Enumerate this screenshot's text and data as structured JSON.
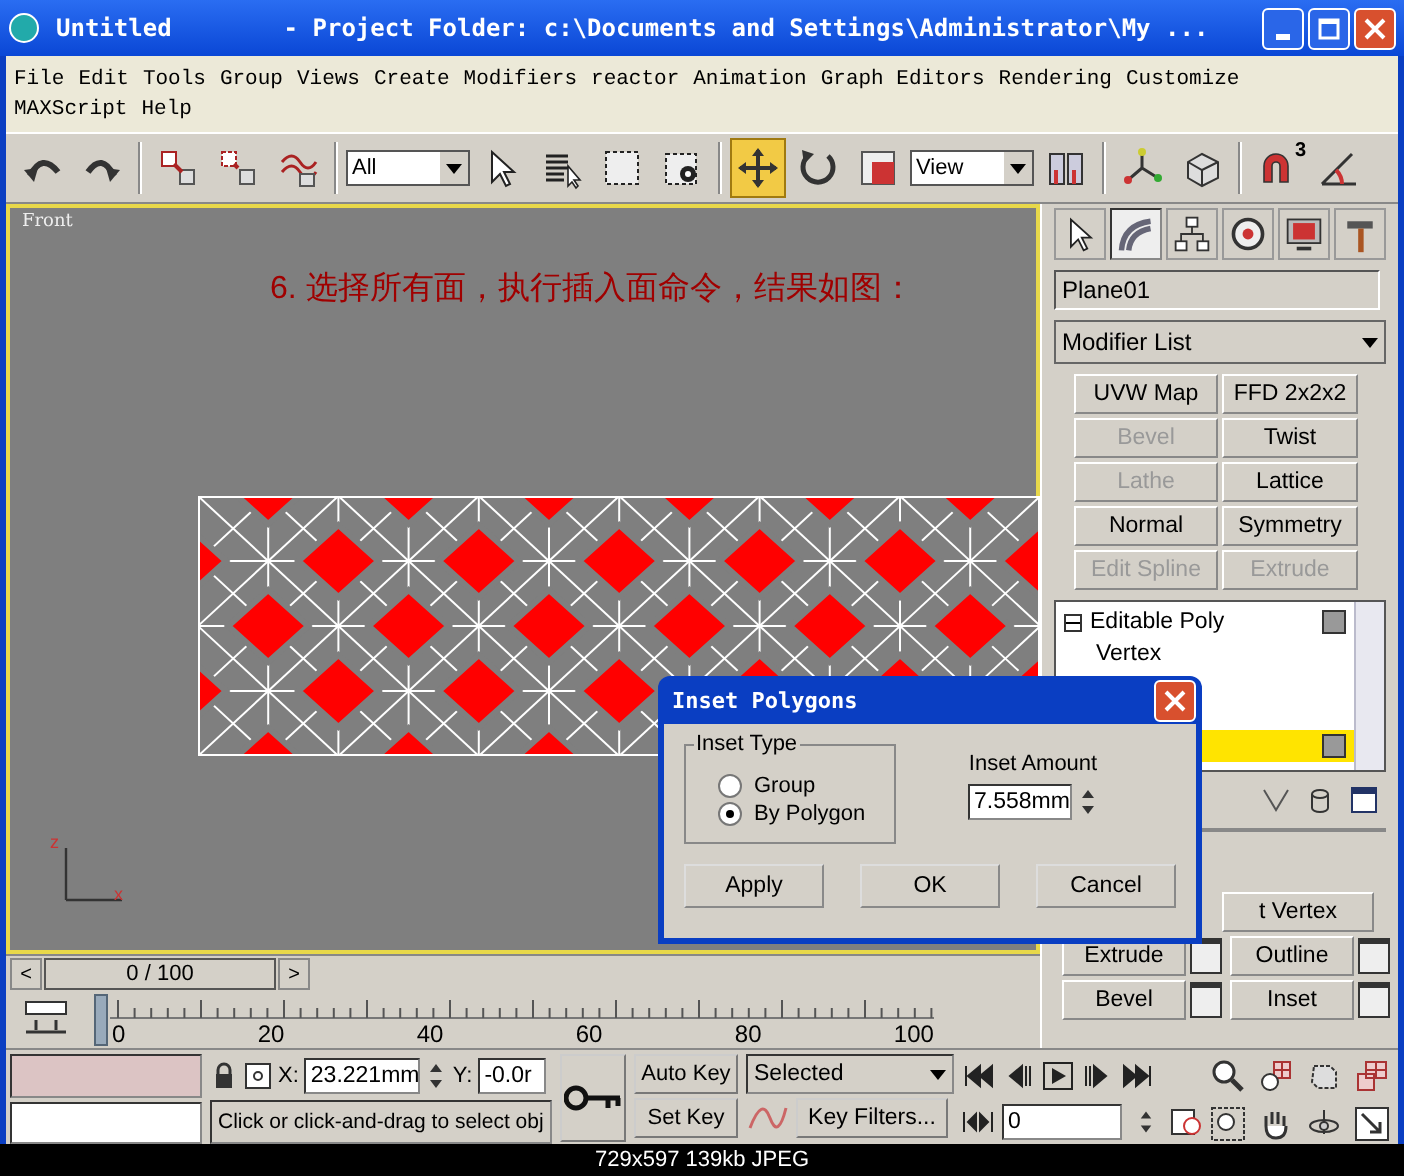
{
  "window": {
    "title": "Untitled",
    "project_folder": "- Project Folder: c:\\Documents and Settings\\Administrator\\My ..."
  },
  "menu_rows": [
    {
      "items": [
        "File",
        "Edit",
        "Tools",
        "Group",
        "Views",
        "Create",
        "Modifiers",
        "reactor",
        "Animation",
        "Graph Editors",
        "Rendering",
        "Customize"
      ]
    },
    {
      "items": [
        "MAXScript",
        "Help"
      ]
    }
  ],
  "toolbar": [
    {
      "kind": "button",
      "selected": false
    },
    {
      "kind": "button",
      "selected": false
    },
    {
      "kind": "separator"
    },
    {
      "kind": "button",
      "selected": false
    },
    {
      "kind": "button",
      "selected": false
    },
    {
      "kind": "button",
      "selected": false
    },
    {
      "kind": "separator"
    },
    {
      "kind": "dropdown",
      "value": "All"
    },
    {
      "kind": "button",
      "selected": false
    },
    {
      "kind": "button",
      "selected": false
    },
    {
      "kind": "button",
      "selected": false
    },
    {
      "kind": "button",
      "selected": false
    },
    {
      "kind": "separator"
    },
    {
      "kind": "button",
      "selected": true
    },
    {
      "kind": "button",
      "selected": false
    },
    {
      "kind": "button",
      "selected": false
    },
    {
      "kind": "dropdown",
      "value": "View"
    },
    {
      "kind": "button",
      "selected": false
    },
    {
      "kind": "separator"
    },
    {
      "kind": "button",
      "selected": false
    },
    {
      "kind": "button",
      "selected": false
    },
    {
      "kind": "separator"
    },
    {
      "kind": "button",
      "selected": false,
      "badge": "3"
    },
    {
      "kind": "button",
      "selected": false
    }
  ],
  "viewport": {
    "label": "Front",
    "caption": "6. 选择所有面，执行插入面命令，结果如图：",
    "axis_labels": [
      "z",
      "x"
    ]
  },
  "command_panel": {
    "tabs": [
      {
        "selected": false
      },
      {
        "selected": true
      },
      {
        "selected": false
      },
      {
        "selected": false
      },
      {
        "selected": false
      },
      {
        "selected": false
      }
    ],
    "object_name": "Plane01",
    "modifier_list": "Modifier List",
    "modifier_buttons": [
      {
        "label": "UVW Map",
        "disabled": false
      },
      {
        "label": "FFD 2x2x2",
        "disabled": false
      },
      {
        "label": "Bevel",
        "disabled": true
      },
      {
        "label": "Twist",
        "disabled": false
      },
      {
        "label": "Lathe",
        "disabled": true
      },
      {
        "label": "Lattice",
        "disabled": false
      },
      {
        "label": "Normal",
        "disabled": false
      },
      {
        "label": "Symmetry",
        "disabled": false
      },
      {
        "label": "Edit Spline",
        "disabled": true
      },
      {
        "label": "Extrude",
        "disabled": true
      }
    ],
    "stack": [
      {
        "label": "Editable Poly",
        "expanded": true,
        "selected": false,
        "children": [
          {
            "label": "Vertex",
            "selected": false
          },
          {
            "selected": true
          }
        ]
      }
    ],
    "rollout_buttons": [
      {
        "kind": "wide",
        "label": "t Vertex"
      },
      {
        "kind": "setting",
        "label": "Extrude"
      },
      {
        "kind": "setting",
        "label": "Outline"
      },
      {
        "kind": "setting",
        "label": "Bevel"
      },
      {
        "kind": "setting",
        "label": "Inset"
      }
    ]
  },
  "time_slider": {
    "prev": "<",
    "label": "0 / 100",
    "next": ">"
  },
  "track_bar": {
    "ticks": [
      "0",
      "20",
      "40",
      "60",
      "80",
      "100"
    ]
  },
  "status": {
    "x_label": "X:",
    "x_value": "23.221mm",
    "y_label": "Y:",
    "y_value": "-0.0r",
    "prompt": "Click or click-and-drag to select obj",
    "auto_key": "Auto Key",
    "set_key": "Set Key",
    "key_mode": "Selected",
    "key_filters": "Key Filters...",
    "frame": "0"
  },
  "dialog": {
    "title": "Inset Polygons",
    "group_label": "Inset Type",
    "options": [
      {
        "label": "Group",
        "selected": false
      },
      {
        "label": "By Polygon",
        "selected": true
      }
    ],
    "amount_label": "Inset Amount",
    "amount": "7.558mm",
    "buttons": [
      "Apply",
      "OK",
      "Cancel"
    ]
  },
  "caption": "729x597 139kb JPEG"
}
